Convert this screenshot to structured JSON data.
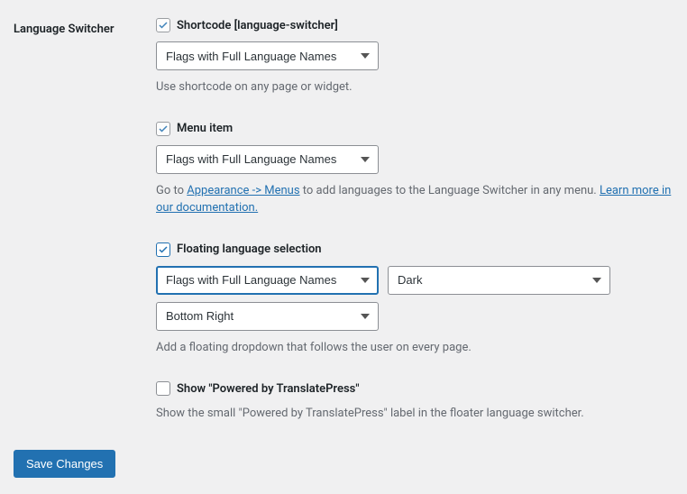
{
  "section_title": "Language Switcher",
  "shortcode": {
    "label": "Shortcode [language-switcher]",
    "select_value": "Flags with Full Language Names",
    "description": "Use shortcode on any page or widget."
  },
  "menuitem": {
    "label": "Menu item",
    "select_value": "Flags with Full Language Names",
    "desc_prefix": "Go to ",
    "desc_link1": "Appearance -> Menus",
    "desc_middle": " to add languages to the Language Switcher in any menu. ",
    "desc_link2": "Learn more in our documentation."
  },
  "floating": {
    "label": "Floating language selection",
    "select_value": "Flags with Full Language Names",
    "theme_value": "Dark",
    "position_value": "Bottom Right",
    "description": "Add a floating dropdown that follows the user on every page."
  },
  "poweredby": {
    "label": "Show \"Powered by TranslatePress\"",
    "description": "Show the small \"Powered by TranslatePress\" label in the floater language switcher."
  },
  "save_button": "Save Changes"
}
